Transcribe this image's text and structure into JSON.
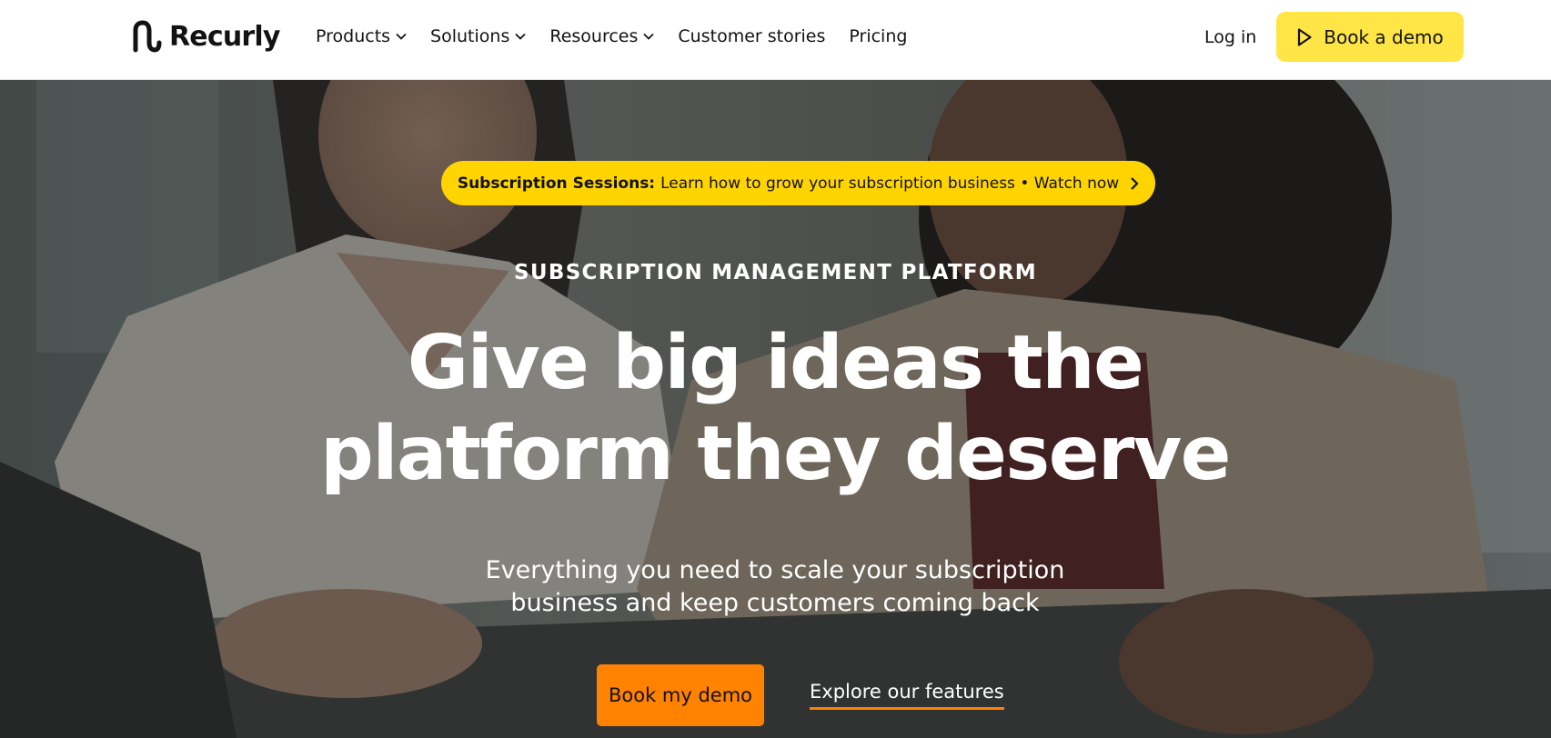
{
  "header": {
    "logo_text": "Recurly",
    "nav": [
      {
        "label": "Products",
        "has_dropdown": true
      },
      {
        "label": "Solutions",
        "has_dropdown": true
      },
      {
        "label": "Resources",
        "has_dropdown": true
      },
      {
        "label": "Customer stories",
        "has_dropdown": false
      },
      {
        "label": "Pricing",
        "has_dropdown": false
      }
    ],
    "login_label": "Log in",
    "demo_button_label": "Book a demo",
    "demo_button_icon": "play-icon"
  },
  "hero": {
    "announcement": {
      "strong": "Subscription Sessions:",
      "text": "Learn how to grow your subscription business • Watch now",
      "icon": "chevron-right-icon"
    },
    "eyebrow": "SUBSCRIPTION MANAGEMENT PLATFORM",
    "headline_line1": "Give big ideas the",
    "headline_line2": "platform they deserve",
    "subhead_line1": "Everything you need to scale your subscription",
    "subhead_line2": "business and keep customers coming back",
    "primary_cta": "Book my demo",
    "secondary_cta": "Explore our features"
  },
  "colors": {
    "accent_yellow": "#ffe545",
    "announcement_yellow": "#ffd400",
    "cta_orange": "#ff8200",
    "text_dark": "#121212"
  }
}
